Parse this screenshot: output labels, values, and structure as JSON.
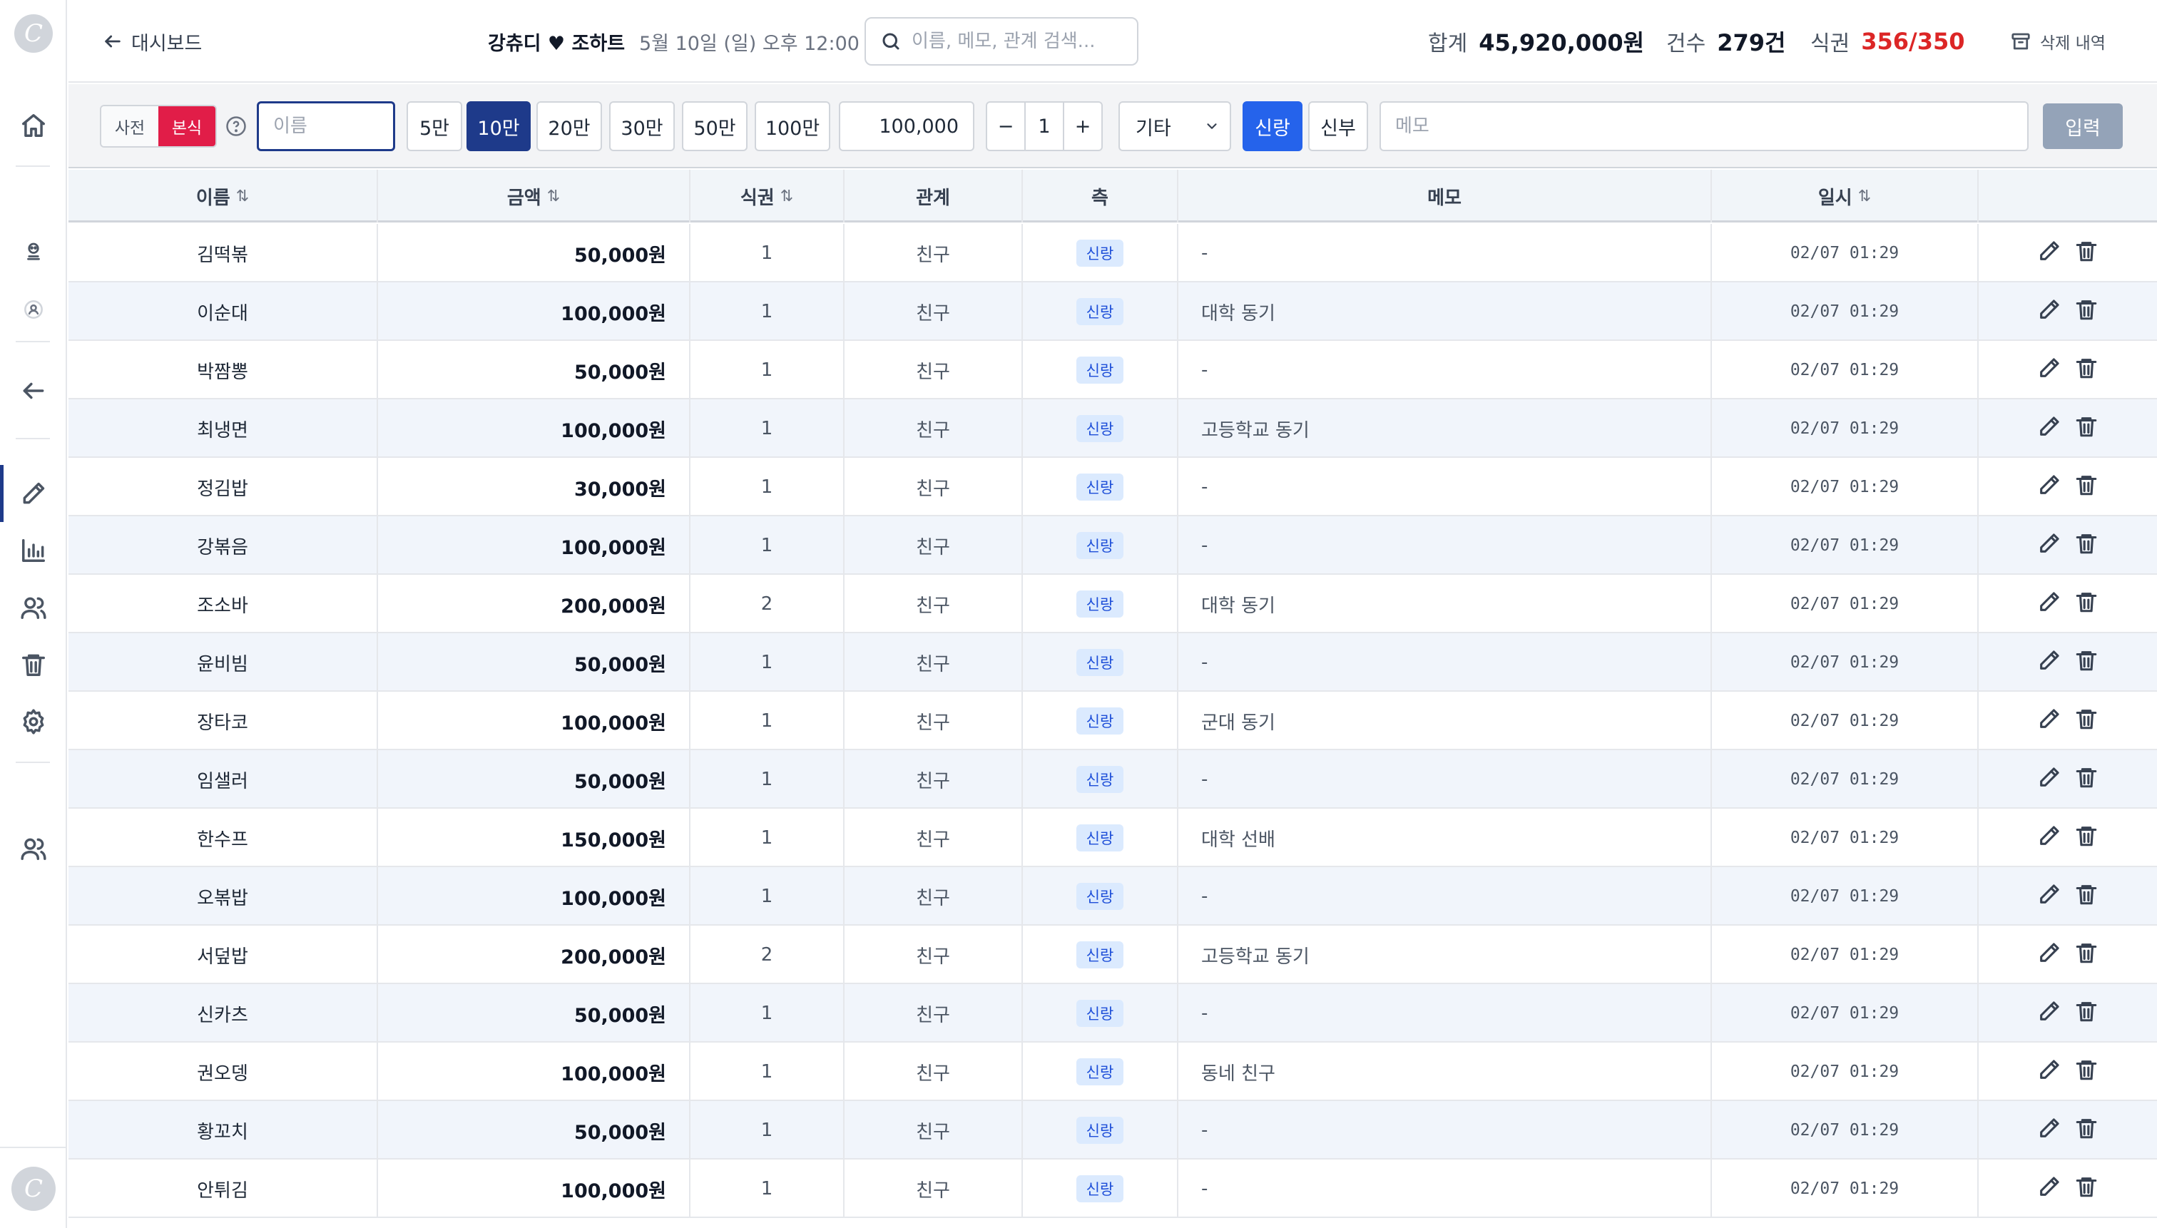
{
  "header": {
    "back_label": "대시보드",
    "couple_title": "강츄디 ♥ 조하트",
    "event_datetime": "5월 10일 (일) 오후 12:00",
    "search_placeholder": "이름, 메모, 관계 검색...",
    "total_label": "합계",
    "total_value": "45,920,000원",
    "count_label": "건수",
    "count_value": "279건",
    "meal_label": "식권",
    "meal_value": "356/350",
    "deleted_label": "삭제 내역"
  },
  "toolbar": {
    "mode_pre": "사전",
    "mode_main": "본식",
    "name_placeholder": "이름",
    "presets": [
      "5만",
      "10만",
      "20만",
      "30만",
      "50만",
      "100만"
    ],
    "active_preset": "10만",
    "amount_value": "100,000",
    "stepper_minus": "−",
    "stepper_value": "1",
    "stepper_plus": "+",
    "relation_value": "기타",
    "side_groom": "신랑",
    "side_bride": "신부",
    "memo_placeholder": "메모",
    "submit_label": "입력"
  },
  "table": {
    "columns": {
      "name": "이름",
      "amount": "금액",
      "meal": "식권",
      "relation": "관계",
      "side": "측",
      "memo": "메모",
      "time": "일시"
    },
    "sort_glyph": "⇅",
    "rows": [
      {
        "name": "김떡볶",
        "amount": "50,000원",
        "meal": "1",
        "relation": "친구",
        "side": "신랑",
        "memo": "-",
        "time": "02/07 01:29"
      },
      {
        "name": "이순대",
        "amount": "100,000원",
        "meal": "1",
        "relation": "친구",
        "side": "신랑",
        "memo": "대학 동기",
        "time": "02/07 01:29"
      },
      {
        "name": "박짬뽕",
        "amount": "50,000원",
        "meal": "1",
        "relation": "친구",
        "side": "신랑",
        "memo": "-",
        "time": "02/07 01:29"
      },
      {
        "name": "최냉면",
        "amount": "100,000원",
        "meal": "1",
        "relation": "친구",
        "side": "신랑",
        "memo": "고등학교 동기",
        "time": "02/07 01:29"
      },
      {
        "name": "정김밥",
        "amount": "30,000원",
        "meal": "1",
        "relation": "친구",
        "side": "신랑",
        "memo": "-",
        "time": "02/07 01:29"
      },
      {
        "name": "강볶음",
        "amount": "100,000원",
        "meal": "1",
        "relation": "친구",
        "side": "신랑",
        "memo": "-",
        "time": "02/07 01:29"
      },
      {
        "name": "조소바",
        "amount": "200,000원",
        "meal": "2",
        "relation": "친구",
        "side": "신랑",
        "memo": "대학 동기",
        "time": "02/07 01:29"
      },
      {
        "name": "윤비빔",
        "amount": "50,000원",
        "meal": "1",
        "relation": "친구",
        "side": "신랑",
        "memo": "-",
        "time": "02/07 01:29"
      },
      {
        "name": "장타코",
        "amount": "100,000원",
        "meal": "1",
        "relation": "친구",
        "side": "신랑",
        "memo": "군대 동기",
        "time": "02/07 01:29"
      },
      {
        "name": "임샐러",
        "amount": "50,000원",
        "meal": "1",
        "relation": "친구",
        "side": "신랑",
        "memo": "-",
        "time": "02/07 01:29"
      },
      {
        "name": "한수프",
        "amount": "150,000원",
        "meal": "1",
        "relation": "친구",
        "side": "신랑",
        "memo": "대학 선배",
        "time": "02/07 01:29"
      },
      {
        "name": "오볶밥",
        "amount": "100,000원",
        "meal": "1",
        "relation": "친구",
        "side": "신랑",
        "memo": "-",
        "time": "02/07 01:29"
      },
      {
        "name": "서덮밥",
        "amount": "200,000원",
        "meal": "2",
        "relation": "친구",
        "side": "신랑",
        "memo": "고등학교 동기",
        "time": "02/07 01:29"
      },
      {
        "name": "신카츠",
        "amount": "50,000원",
        "meal": "1",
        "relation": "친구",
        "side": "신랑",
        "memo": "-",
        "time": "02/07 01:29"
      },
      {
        "name": "권오뎅",
        "amount": "100,000원",
        "meal": "1",
        "relation": "친구",
        "side": "신랑",
        "memo": "동네 친구",
        "time": "02/07 01:29"
      },
      {
        "name": "황꼬치",
        "amount": "50,000원",
        "meal": "1",
        "relation": "친구",
        "side": "신랑",
        "memo": "-",
        "time": "02/07 01:29"
      },
      {
        "name": "안튀김",
        "amount": "100,000원",
        "meal": "1",
        "relation": "친구",
        "side": "신랑",
        "memo": "-",
        "time": "02/07 01:29"
      }
    ]
  },
  "colors": {
    "primary": "#1e3a8a",
    "accent_red": "#e11d48",
    "groom_blue": "#2563eb",
    "meal_over": "#dc2626"
  }
}
